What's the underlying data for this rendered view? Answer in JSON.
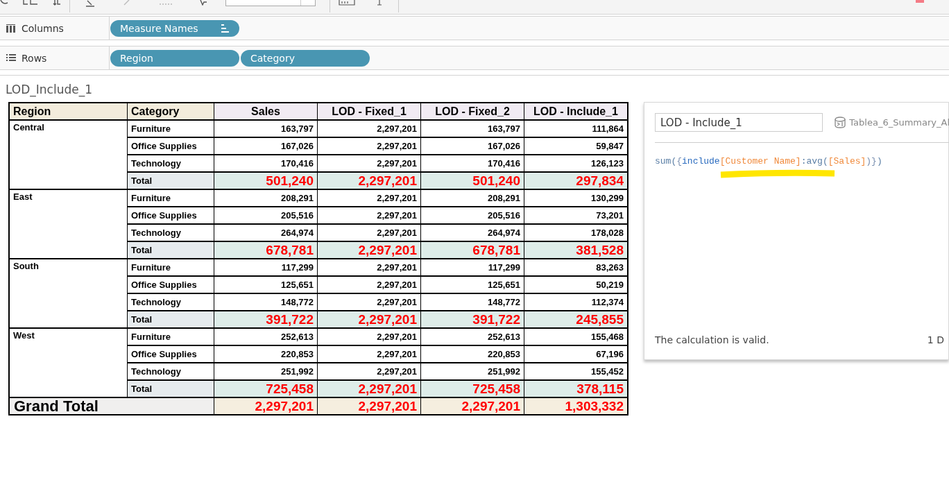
{
  "shelves": [
    {
      "kind": "columns",
      "label": "Columns",
      "pills": [
        {
          "label": "Measure Names",
          "sorted": true
        }
      ]
    },
    {
      "kind": "rows",
      "label": "Rows",
      "pills": [
        {
          "label": "Region",
          "sorted": false
        },
        {
          "label": "Category",
          "sorted": false
        }
      ]
    }
  ],
  "sheet": {
    "title": "LOD_Include_1",
    "table": {
      "dimension_headers": [
        "Region",
        "Category"
      ],
      "measure_headers": [
        "Sales",
        "LOD - Fixed_1",
        "LOD - Fixed_2",
        "LOD - Include_1"
      ],
      "regions": [
        {
          "region": "Central",
          "rows": [
            {
              "category": "Furniture",
              "values": [
                "163,797",
                "2,297,201",
                "163,797",
                "111,864"
              ]
            },
            {
              "category": "Office Supplies",
              "values": [
                "167,026",
                "2,297,201",
                "167,026",
                "59,847"
              ]
            },
            {
              "category": "Technology",
              "values": [
                "170,416",
                "2,297,201",
                "170,416",
                "126,123"
              ]
            }
          ],
          "total": {
            "label": "Total",
            "values": [
              "501,240",
              "2,297,201",
              "501,240",
              "297,834"
            ]
          }
        },
        {
          "region": "East",
          "rows": [
            {
              "category": "Furniture",
              "values": [
                "208,291",
                "2,297,201",
                "208,291",
                "130,299"
              ]
            },
            {
              "category": "Office Supplies",
              "values": [
                "205,516",
                "2,297,201",
                "205,516",
                "73,201"
              ]
            },
            {
              "category": "Technology",
              "values": [
                "264,974",
                "2,297,201",
                "264,974",
                "178,028"
              ]
            }
          ],
          "total": {
            "label": "Total",
            "values": [
              "678,781",
              "2,297,201",
              "678,781",
              "381,528"
            ]
          }
        },
        {
          "region": "South",
          "rows": [
            {
              "category": "Furniture",
              "values": [
                "117,299",
                "2,297,201",
                "117,299",
                "83,263"
              ]
            },
            {
              "category": "Office Supplies",
              "values": [
                "125,651",
                "2,297,201",
                "125,651",
                "50,219"
              ]
            },
            {
              "category": "Technology",
              "values": [
                "148,772",
                "2,297,201",
                "148,772",
                "112,374"
              ]
            }
          ],
          "total": {
            "label": "Total",
            "values": [
              "391,722",
              "2,297,201",
              "391,722",
              "245,855"
            ]
          }
        },
        {
          "region": "West",
          "rows": [
            {
              "category": "Furniture",
              "values": [
                "252,613",
                "2,297,201",
                "252,613",
                "155,468"
              ]
            },
            {
              "category": "Office Supplies",
              "values": [
                "220,853",
                "2,297,201",
                "220,853",
                "67,196"
              ]
            },
            {
              "category": "Technology",
              "values": [
                "251,992",
                "2,297,201",
                "251,992",
                "155,452"
              ]
            }
          ],
          "total": {
            "label": "Total",
            "values": [
              "725,458",
              "2,297,201",
              "725,458",
              "378,115"
            ]
          }
        }
      ],
      "grand_total": {
        "label": "Grand Total",
        "values": [
          "2,297,201",
          "2,297,201",
          "2,297,201",
          "1,303,332"
        ]
      }
    }
  },
  "calc_editor": {
    "name": "LOD - Include_1",
    "data_source": "Tablea_6_Summary_Al",
    "formula": [
      {
        "kind": "func",
        "text": "sum("
      },
      {
        "kind": "punct",
        "text": "{"
      },
      {
        "kind": "keyword",
        "text": "include"
      },
      {
        "kind": "field",
        "text": "[Customer Name]"
      },
      {
        "kind": "func",
        "text": ":avg("
      },
      {
        "kind": "field",
        "text": "[Sales]"
      },
      {
        "kind": "punct",
        "text": ")}"
      },
      {
        "kind": "func",
        "text": ")"
      }
    ],
    "status": "The calculation is valid.",
    "dependencies": "1 D"
  }
}
